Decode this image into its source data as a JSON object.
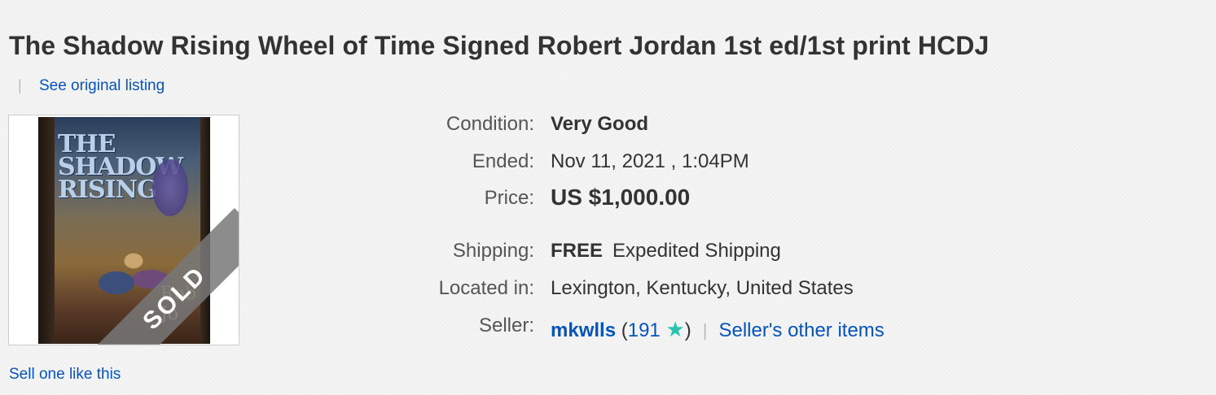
{
  "listing": {
    "title": "The Shadow Rising Wheel of Time Signed Robert Jordan 1st ed/1st print HCDJ",
    "see_original": "See original listing",
    "sell_one": "Sell one like this",
    "sold_badge": "SOLD"
  },
  "cover": {
    "title_line1": "THE SHADOW",
    "title_line2": "RISING",
    "author": "Robe\nJo"
  },
  "details": {
    "condition_label": "Condition:",
    "condition_value": "Very Good",
    "ended_label": "Ended:",
    "ended_value": "Nov 11, 2021 , 1:04PM",
    "price_label": "Price:",
    "price_value": "US $1,000.00",
    "shipping_label": "Shipping:",
    "shipping_free": "FREE",
    "shipping_method": "Expedited Shipping",
    "located_label": "Located in:",
    "located_value": "Lexington, Kentucky, United States",
    "seller_label": "Seller:",
    "seller_name": "mkwlls",
    "seller_feedback_open": "(",
    "seller_feedback_count": "191",
    "seller_feedback_close": ")",
    "seller_other_items": "Seller's other items"
  },
  "colors": {
    "link": "#0654ba",
    "star": "#27c2b0",
    "background": "#f4f4f4"
  },
  "icons": [
    "star-icon"
  ]
}
